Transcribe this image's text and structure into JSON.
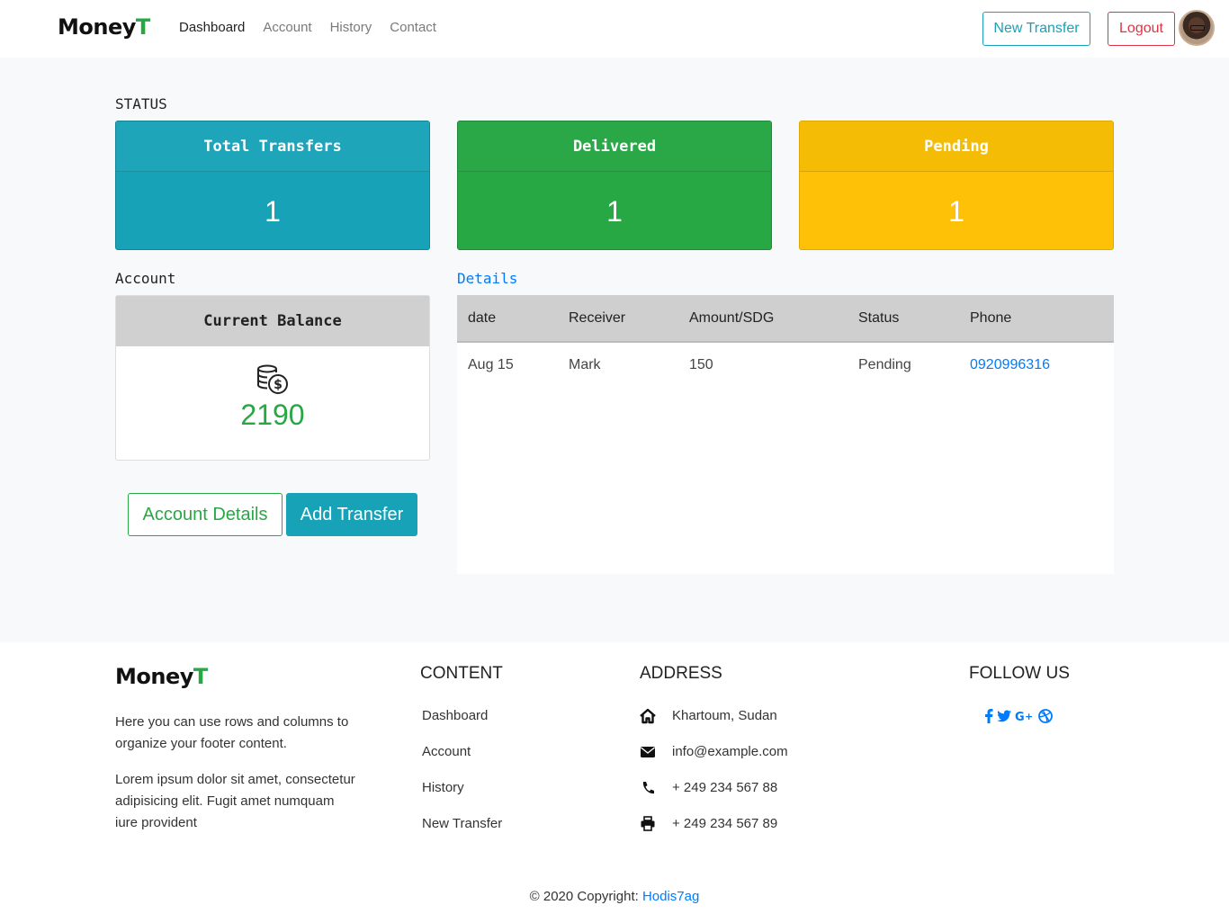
{
  "brand": {
    "name_main": "Money",
    "name_accent": "T"
  },
  "nav": {
    "items": [
      {
        "label": "Dashboard",
        "active": true
      },
      {
        "label": "Account"
      },
      {
        "label": "History"
      },
      {
        "label": "Contact"
      }
    ]
  },
  "header_actions": {
    "new_transfer": "New Transfer",
    "logout": "Logout"
  },
  "status": {
    "label": "STATUS",
    "cards": [
      {
        "title": "Total Transfers",
        "value": "1",
        "color": "#17a2b8"
      },
      {
        "title": "Delivered",
        "value": "1",
        "color": "#28a745"
      },
      {
        "title": "Pending",
        "value": "1",
        "color": "#ffc107"
      }
    ]
  },
  "account": {
    "label": "Account",
    "balance_title": "Current Balance",
    "balance_icon": "coins-dollar-icon",
    "balance_value": "2190",
    "details_button": "Account Details",
    "add_transfer_button": "Add Transfer"
  },
  "details": {
    "label": "Details",
    "columns": [
      "date",
      "Receiver",
      "Amount/SDG",
      "Status",
      "Phone"
    ],
    "rows": [
      {
        "date": "Aug 15",
        "receiver": "Mark",
        "amount": "150",
        "status": "Pending",
        "phone": "0920996316"
      }
    ]
  },
  "footer": {
    "brand_main": "Money",
    "brand_accent": "T",
    "text1": "Here you can use rows and columns to organize your footer content.",
    "text2": "Lorem ipsum dolor sit amet, consectetur adipisicing elit. Fugit amet numquam iure provident",
    "content_title": "CONTENT",
    "content_links": [
      "Dashboard",
      "Account",
      "History",
      "New Transfer"
    ],
    "address_title": "ADDRESS",
    "address": [
      {
        "icon": "home-icon",
        "text": "Khartoum, Sudan"
      },
      {
        "icon": "envelope-icon",
        "text": "info@example.com"
      },
      {
        "icon": "phone-icon",
        "text": "+ 249 234 567 88"
      },
      {
        "icon": "print-icon",
        "text": "+ 249 234 567 89"
      }
    ],
    "follow_title": "FOLLOW US",
    "social": [
      "facebook-icon",
      "twitter-icon",
      "google-plus-icon",
      "dribbble-icon"
    ],
    "copyright_prefix": "© 2020 Copyright:",
    "copyright_link": "Hodis7ag"
  }
}
